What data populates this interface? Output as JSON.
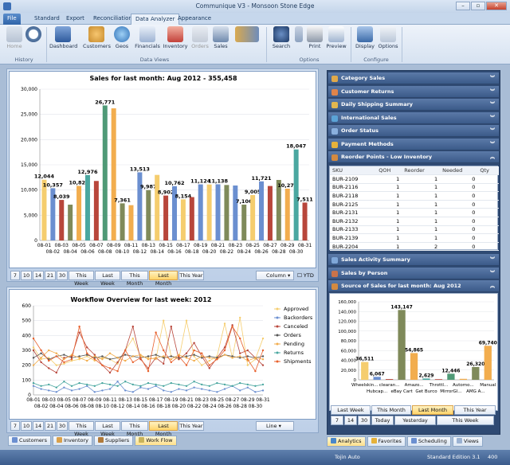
{
  "app": {
    "title": "Communique V3 - Monsoon Stone Edge"
  },
  "tabs": [
    "File",
    "Standard",
    "Export",
    "Reconciliation",
    "Data Analyzer",
    "Appearance"
  ],
  "ribbon": {
    "home": "Home",
    "history": "History",
    "dashboard": "Dashboard",
    "customers": "Customers",
    "geos": "Geos",
    "financials": "Financials",
    "inventory": "Inventory",
    "orders": "Orders",
    "sales": "Sales",
    "data_views": "Data Views",
    "search": "Search",
    "print": "Print",
    "preview": "Preview",
    "options_group": "Options",
    "display": "Display",
    "options": "Options",
    "configure": "Configure"
  },
  "sales_chart": {
    "title": "Sales for last month: Aug 2012 - 355,458",
    "column": "Column",
    "ytd": "YTD"
  },
  "workflow_chart": {
    "title": "Workflow Overview  for last week: 2012",
    "line": "Line"
  },
  "filters": [
    "7",
    "10",
    "14",
    "21",
    "30",
    "This Week",
    "Last Week",
    "This Month",
    "Last Month",
    "This Year"
  ],
  "filter_selected": "Last Month",
  "bottom_tabs": [
    "Customers",
    "Inventory",
    "Suppliers",
    "Work Flow"
  ],
  "bottom_selected": "Work Flow",
  "right": {
    "sections": [
      "Category Sales",
      "Customer Returns",
      "Daily Shipping Summary",
      "International Sales",
      "Order Status",
      "Payment Methods",
      "Reorder Points - Low Inventory"
    ],
    "sections2": [
      "Sales Activity Summary",
      "Sales by Person",
      "Source of Sales  for last month: Aug 2012"
    ],
    "reorder_headers": [
      "SKU",
      "QOH",
      "Reorder",
      "Needed",
      "Qty"
    ],
    "reorder_rows": [
      [
        "BUR-2109",
        "1",
        "1",
        "0"
      ],
      [
        "BUR-2116",
        "1",
        "1",
        "0"
      ],
      [
        "BUR-2118",
        "1",
        "1",
        "0"
      ],
      [
        "BUR-2125",
        "1",
        "1",
        "0"
      ],
      [
        "BUR-2131",
        "1",
        "1",
        "0"
      ],
      [
        "BUR-2132",
        "1",
        "1",
        "0"
      ],
      [
        "BUR-2133",
        "1",
        "1",
        "0"
      ],
      [
        "BUR-2139",
        "1",
        "1",
        "0"
      ],
      [
        "BUR-2204",
        "1",
        "2",
        "0"
      ]
    ],
    "source_filters_row1": [
      "Last Week",
      "This Month",
      "Last Month",
      "This Year"
    ],
    "source_filters_row2": [
      "7",
      "14",
      "30",
      "Today",
      "Yesterday",
      "This Week"
    ],
    "source_selected": "Last Month",
    "bottom_tabs": [
      "Analytics",
      "Favorites",
      "Scheduling",
      "Views"
    ],
    "bottom_selected": "Analytics"
  },
  "status": {
    "user": "Tojin Auto",
    "edition": "Standard Edition 3.1",
    "version": "400"
  },
  "colors": {
    "blue": "#6b8fd0",
    "orange": "#f2ad4e",
    "olive": "#7f8a5a",
    "darkred": "#b8463b",
    "green": "#4f9a77",
    "yellow": "#f5cd6e",
    "teal": "#4aa7a0"
  },
  "chart_data": [
    {
      "type": "bar",
      "title": "Sales for last month: Aug 2012 - 355,458",
      "ylim": [
        0,
        30000
      ],
      "yticks": [
        0,
        5000,
        10000,
        15000,
        20000,
        25000,
        30000
      ],
      "categories": [
        "08-01",
        "08-02",
        "08-03",
        "08-04",
        "08-05",
        "08-06",
        "08-07",
        "08-08",
        "08-09",
        "08-10",
        "08-11",
        "08-12",
        "08-13",
        "08-14",
        "08-15",
        "08-16",
        "08-17",
        "08-18",
        "08-19",
        "08-20",
        "08-21",
        "08-22",
        "08-23",
        "08-24",
        "08-25",
        "08-26",
        "08-27",
        "08-28",
        "08-29",
        "08-30",
        "08-31"
      ],
      "values": [
        12044,
        10357,
        8039,
        7100,
        10823,
        12976,
        11800,
        26771,
        26200,
        7361,
        7000,
        13513,
        9987,
        13000,
        8902,
        10762,
        8154,
        8600,
        11124,
        11100,
        11138,
        11000,
        10900,
        7106,
        9005,
        11721,
        10800,
        12000,
        10273,
        18047,
        7511
      ],
      "labels": [
        "12,044",
        "10,357",
        "8,039",
        "",
        "10,823",
        "12,976",
        "",
        "26,771",
        "",
        "7,361",
        "",
        "13,513",
        "9,987",
        "",
        "8,902",
        "10,762",
        "8,154",
        "",
        "11,124",
        "",
        "11,138",
        "",
        "",
        "7,106",
        "9,005",
        "11,721",
        "",
        "",
        "10,273",
        "18,047",
        "7,511"
      ]
    },
    {
      "type": "line",
      "title": "Workflow Overview  for last week: 2012",
      "ylim": [
        0,
        600
      ],
      "yticks": [
        0,
        100,
        200,
        300,
        400,
        500,
        600
      ],
      "categories": [
        "08-01",
        "08-02",
        "08-03",
        "08-04",
        "08-05",
        "08-06",
        "08-07",
        "08-08",
        "08-09",
        "08-10",
        "08-11",
        "08-12",
        "08-13",
        "08-14",
        "08-15",
        "08-16",
        "08-17",
        "08-18",
        "08-19",
        "08-20",
        "08-21",
        "08-22",
        "08-23",
        "08-24",
        "08-25",
        "08-26",
        "08-27",
        "08-28",
        "08-29",
        "08-30",
        "08-31"
      ],
      "series": [
        {
          "name": "Approved",
          "color": "#f5cd6e",
          "values": [
            320,
            240,
            250,
            200,
            210,
            230,
            240,
            260,
            230,
            250,
            240,
            210,
            300,
            380,
            260,
            250,
            240,
            500,
            260,
            240,
            500,
            260,
            200,
            230,
            260,
            480,
            250,
            520,
            200,
            240,
            380
          ]
        },
        {
          "name": "Backorders",
          "color": "#6b8fd0",
          "values": [
            60,
            40,
            30,
            20,
            50,
            30,
            40,
            60,
            20,
            30,
            40,
            90,
            30,
            20,
            50,
            40,
            60,
            30,
            20,
            40,
            30,
            50,
            40,
            30,
            20,
            40,
            60,
            30,
            50,
            20,
            30
          ]
        },
        {
          "name": "Canceled",
          "color": "#b8463b",
          "values": [
            300,
            220,
            180,
            150,
            250,
            260,
            420,
            320,
            270,
            200,
            150,
            220,
            300,
            460,
            240,
            180,
            250,
            210,
            460,
            240,
            280,
            350,
            260,
            180,
            250,
            320,
            470,
            280,
            300,
            250,
            200
          ]
        },
        {
          "name": "Orders",
          "color": "#555555",
          "values": [
            250,
            280,
            240,
            260,
            270,
            250,
            260,
            270,
            250,
            260,
            240,
            250,
            270,
            260,
            250,
            260,
            270,
            250,
            260,
            250,
            260,
            270,
            250,
            260,
            250,
            270,
            260,
            250,
            260,
            250,
            260
          ]
        },
        {
          "name": "Pending",
          "color": "#f2ad4e",
          "values": [
            200,
            250,
            300,
            280,
            240,
            270,
            250,
            230,
            260,
            240,
            280,
            250,
            230,
            260,
            270,
            240,
            250,
            260,
            240,
            270,
            250,
            230,
            260,
            250,
            240,
            270,
            250,
            260,
            230,
            250,
            240
          ]
        },
        {
          "name": "Returns",
          "color": "#4aa7a0",
          "values": [
            80,
            60,
            70,
            50,
            90,
            60,
            80,
            70,
            60,
            80,
            70,
            60,
            90,
            70,
            60,
            80,
            70,
            60,
            80,
            70,
            60,
            90,
            70,
            60,
            80,
            70,
            60,
            80,
            70,
            60,
            70
          ]
        },
        {
          "name": "Shipments",
          "color": "#e8602c",
          "values": [
            380,
            300,
            230,
            260,
            220,
            240,
            460,
            280,
            240,
            200,
            180,
            160,
            300,
            220,
            250,
            160,
            420,
            300,
            220,
            260,
            200,
            300,
            280,
            200,
            240,
            300,
            460,
            380,
            240,
            160,
            300
          ]
        }
      ]
    },
    {
      "type": "bar",
      "title": "Source of Sales  for last month: Aug 2012",
      "ylim": [
        0,
        160000
      ],
      "yticks": [
        0,
        20000,
        40000,
        60000,
        80000,
        100000,
        120000,
        140000,
        160000
      ],
      "categories": [
        "Wheelskin...",
        "Hubcap...",
        "clearan...",
        "eBay Cart",
        "Amazo...",
        "Get Burco",
        "Throttl...",
        "MirrorGl...",
        "Automo...",
        "AMG A...",
        "Manual"
      ],
      "values": [
        36511,
        6067,
        1500,
        143147,
        54865,
        2629,
        1200,
        12446,
        2000,
        26320,
        69740
      ],
      "labels": [
        "36,511",
        "6,067",
        "",
        "143,147",
        "54,865",
        "2,629",
        "",
        "12,446",
        "",
        "26,320",
        "69,740"
      ]
    }
  ]
}
